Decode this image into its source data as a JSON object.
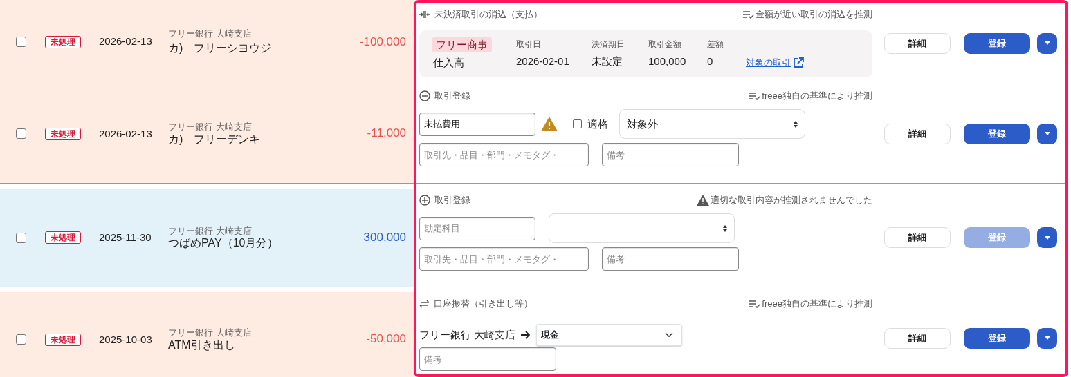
{
  "transactions": [
    {
      "kind": "withdrawal",
      "checked": false,
      "status": "未処理",
      "date": "2026-02-13",
      "bank": "フリー銀行 大崎支店",
      "description": "カ)　フリーシヨウジ",
      "amount": "-100,000",
      "action": {
        "kind": "reconcile",
        "title": "未決済取引の消込（支払）",
        "hint": {
          "kind": "suggest",
          "text": "金額が近い取引の消込を推測"
        },
        "match": {
          "partner": "フリー商事",
          "account": "仕入高",
          "fields": [
            {
              "label": "取引日",
              "value": "2026-02-01"
            },
            {
              "label": "決済期日",
              "value": "未設定"
            },
            {
              "label": "取引金額",
              "value": "100,000"
            },
            {
              "label": "差額",
              "value": "0"
            }
          ],
          "link": "対象の取引"
        },
        "buttons": {
          "detail": "詳細",
          "register": "登録",
          "register_disabled": false
        }
      }
    },
    {
      "kind": "withdrawal",
      "checked": false,
      "status": "未処理",
      "date": "2026-02-13",
      "bank": "フリー銀行 大崎支店",
      "description": "カ)　フリーデンキ",
      "amount": "-11,000",
      "action": {
        "kind": "register",
        "expanded": true,
        "title": "取引登録",
        "hint": {
          "kind": "suggest",
          "text": "freee独自の基準により推測"
        },
        "account": {
          "value": "未払費用",
          "warning": true
        },
        "qualified": {
          "label": "適格",
          "checked": false
        },
        "tax": "対象外",
        "tags": {
          "placeholder": "取引先・品目・部門・メモタグ・"
        },
        "note": {
          "placeholder": "備考"
        },
        "buttons": {
          "detail": "詳細",
          "register": "登録",
          "register_disabled": false
        }
      }
    },
    {
      "kind": "deposit",
      "checked": false,
      "status": "未処理",
      "date": "2025-11-30",
      "bank": "フリー銀行 大崎支店",
      "description": "つばめPAY（10月分）",
      "amount": "300,000",
      "action": {
        "kind": "register",
        "expanded": false,
        "title": "取引登録",
        "hint": {
          "kind": "warning",
          "text": "適切な取引内容が推測されませんでした"
        },
        "account": {
          "placeholder": "勘定科目",
          "warning": false
        },
        "tags": {
          "placeholder": "取引先・品目・部門・メモタグ・"
        },
        "note": {
          "placeholder": "備考"
        },
        "buttons": {
          "detail": "詳細",
          "register": "登録",
          "register_disabled": true
        }
      }
    },
    {
      "kind": "withdrawal",
      "checked": false,
      "status": "未処理",
      "date": "2025-10-03",
      "bank": "フリー銀行 大崎支店",
      "description": "ATM引き出し",
      "amount": "-50,000",
      "action": {
        "kind": "transfer",
        "title": "口座振替（引き出し等）",
        "hint": {
          "kind": "suggest",
          "text": "freee独自の基準により推測"
        },
        "from": "フリー銀行 大崎支店",
        "to": "現金",
        "note": {
          "placeholder": "備考"
        },
        "buttons": {
          "detail": "詳細",
          "register": "登録",
          "register_disabled": false
        }
      }
    }
  ]
}
